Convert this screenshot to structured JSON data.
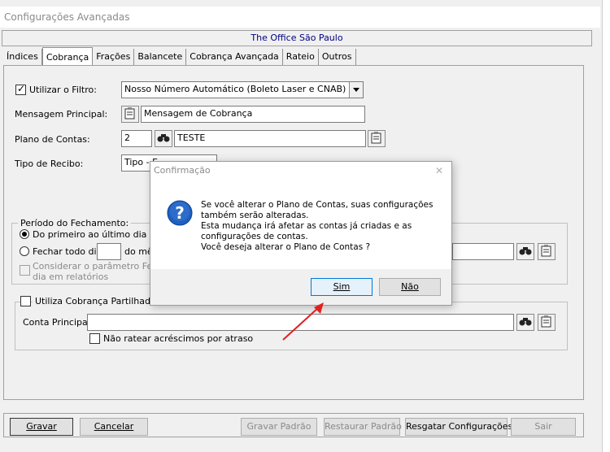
{
  "window": {
    "title": "Configurações Avançadas"
  },
  "company": {
    "name": "The Office São Paulo"
  },
  "tabs": [
    {
      "label": "Índices"
    },
    {
      "label": "Cobrança"
    },
    {
      "label": "Frações"
    },
    {
      "label": "Balancete"
    },
    {
      "label": "Cobrança Avançada"
    },
    {
      "label": "Rateio"
    },
    {
      "label": "Outros"
    }
  ],
  "active_tab": "Cobrança",
  "form": {
    "filtro_label": "Utilizar o Filtro:",
    "filtro_checked": true,
    "filtro_value": "Nosso Número Automático (Boleto Laser e CNAB)",
    "mensagem_label": "Mensagem Principal:",
    "mensagem_value": "Mensagem de Cobrança",
    "plano_label": "Plano de Contas:",
    "plano_code": "2",
    "plano_name": "TESTE",
    "recibo_label": "Tipo de Recibo:",
    "recibo_value": "Tipo - E"
  },
  "periodo": {
    "title": "Período do Fechamento:",
    "option1": "Do primeiro ao último dia do m",
    "option2_prefix": "Fechar todo dia",
    "option2_suffix": "do mês",
    "day_value": "",
    "consider_line1": "Considerar o parâmetro Fecha",
    "consider_line2": "dia em relatórios"
  },
  "partilhada": {
    "title": "Utiliza Cobrança Partilhada (R",
    "conta_label": "Conta Principal:",
    "conta_value": "",
    "nao_ratear": "Não ratear acréscimos por atraso"
  },
  "buttons": {
    "gravar": "Gravar",
    "cancelar": "Cancelar",
    "gravar_padrao": "Gravar Padrão",
    "restaurar_padrao": "Restaurar Padrão",
    "resgatar": "Resgatar Configurações",
    "sair": "Sair"
  },
  "dialog": {
    "title": "Confirmação",
    "close": "✕",
    "lines": [
      "Se você alterar o Plano de Contas, suas configurações",
      "também serão alteradas.",
      "Esta mudança irá afetar as contas já criadas e as",
      "configurações de contas.",
      "Você deseja alterar o Plano de Contas ?"
    ],
    "yes": "Sim",
    "no": "Não"
  },
  "colors": {
    "company_text": "#000080",
    "annotation_arrow": "#e02020",
    "dialog_icon": "#1f5fbf"
  }
}
